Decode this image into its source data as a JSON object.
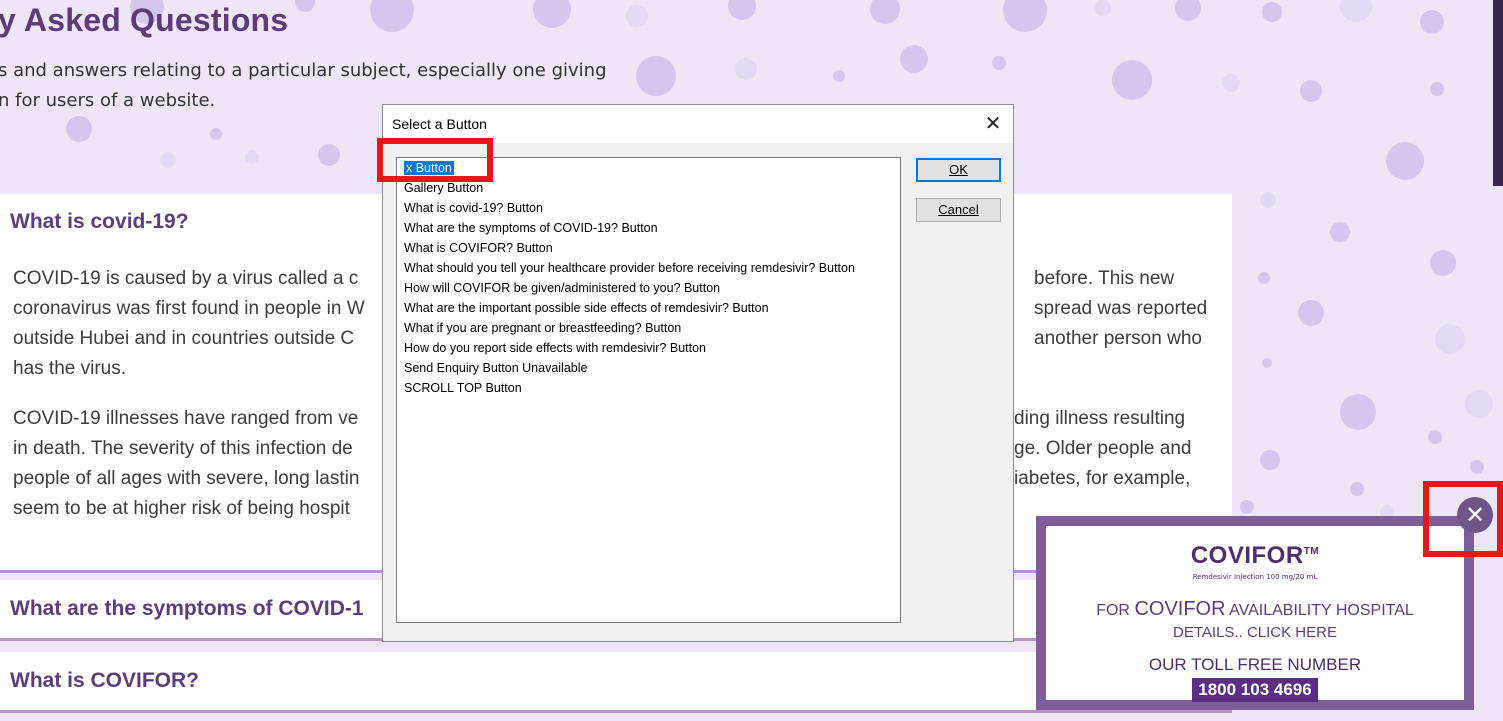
{
  "page": {
    "title": "y Asked Questions",
    "subtitle_line1": "s and answers relating to a particular subject, especially one giving",
    "subtitle_line2": "n for users of a website."
  },
  "faq": {
    "q1": "What is covid-19?",
    "p1": [
      "COVID-19 is caused by a virus called a c",
      "coronavirus was first found in people in W",
      "outside Hubei and in countries outside C",
      "has the virus."
    ],
    "p1_right": [
      "before. This new",
      "spread was reported",
      "another person who"
    ],
    "p2": [
      "COVID-19 illnesses have ranged from ve",
      "in death. The severity of this infection de",
      "people of all ages with severe, long lastin",
      "seem to be at higher risk of being hospit"
    ],
    "p2_right": [
      "ding illness resulting",
      "ge. Older people and",
      "iabetes, for example,"
    ],
    "q2": "What are the symptoms of COVID-1",
    "q3": "What is COVIFOR?"
  },
  "dialog": {
    "title": "Select a Button",
    "close_glyph": "✕",
    "items": [
      "x Button",
      "Gallery  Button",
      "What is covid-19? Button",
      "What are the symptoms of COVID-19? Button",
      "What is COVIFOR? Button",
      "What should you tell your healthcare provider before receiving remdesivir? Button",
      "How will COVIFOR be given/administered to you? Button",
      "What are the important possible side effects of remdesivir? Button",
      "What if you are pregnant or breastfeeding? Button",
      "How do you report side effects with remdesivir? Button",
      "Send Enquiry Button  Unavailable",
      "SCROLL TOP Button"
    ],
    "ok_label": "OK",
    "cancel_label": "Cancel"
  },
  "ad": {
    "logo": "COVIFOR",
    "logo_tm": "TM",
    "logo_sub": "Remdesivir Injection 100 mg/20 mL",
    "line1_prefix": "FOR",
    "line1_brand": "COVIFOR",
    "line1_suffix": "AVAILABILITY HOSPITAL",
    "line2": "DETAILS.. CLICK HERE",
    "line3": "OUR TOLL FREE NUMBER",
    "phone": "1800 103 4696",
    "close_glyph": "✕"
  }
}
